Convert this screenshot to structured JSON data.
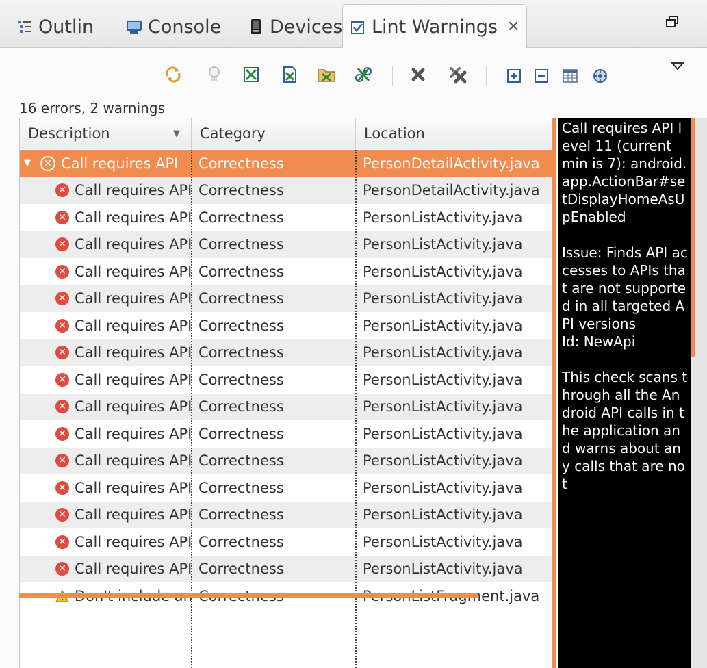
{
  "tabs": [
    {
      "label": "Outlin",
      "icon": "outline-icon",
      "active": false
    },
    {
      "label": "Console",
      "icon": "console-icon",
      "active": false
    },
    {
      "label": "Devices",
      "icon": "devices-icon",
      "active": false
    },
    {
      "label": "Lint Warnings",
      "icon": "lint-icon",
      "active": true
    }
  ],
  "toolbar": {
    "buttons": [
      "refresh-icon",
      "lightbulb-icon",
      "ignore-icon",
      "ignore-file-icon",
      "ignore-project-icon",
      "ignore-all-icon",
      "remove-icon",
      "remove-all-icon",
      "expand-all-icon",
      "collapse-all-icon",
      "columns-icon",
      "options-icon"
    ]
  },
  "summary": "16 errors, 2 warnings",
  "table": {
    "columns": [
      "Description",
      "Category",
      "Location"
    ],
    "rows": [
      {
        "icon": "error",
        "description": "Call requires API",
        "category": "Correctness",
        "location": "PersonDetailActivity.java",
        "selected": true,
        "expander": true
      },
      {
        "icon": "error",
        "description": "Call requires API",
        "category": "Correctness",
        "location": "PersonDetailActivity.java"
      },
      {
        "icon": "error",
        "description": "Call requires API",
        "category": "Correctness",
        "location": "PersonListActivity.java"
      },
      {
        "icon": "error",
        "description": "Call requires API",
        "category": "Correctness",
        "location": "PersonListActivity.java"
      },
      {
        "icon": "error",
        "description": "Call requires API",
        "category": "Correctness",
        "location": "PersonListActivity.java"
      },
      {
        "icon": "error",
        "description": "Call requires API",
        "category": "Correctness",
        "location": "PersonListActivity.java"
      },
      {
        "icon": "error",
        "description": "Call requires API",
        "category": "Correctness",
        "location": "PersonListActivity.java"
      },
      {
        "icon": "error",
        "description": "Call requires API",
        "category": "Correctness",
        "location": "PersonListActivity.java"
      },
      {
        "icon": "error",
        "description": "Call requires API",
        "category": "Correctness",
        "location": "PersonListActivity.java"
      },
      {
        "icon": "error",
        "description": "Call requires API",
        "category": "Correctness",
        "location": "PersonListActivity.java"
      },
      {
        "icon": "error",
        "description": "Call requires API",
        "category": "Correctness",
        "location": "PersonListActivity.java"
      },
      {
        "icon": "error",
        "description": "Call requires API",
        "category": "Correctness",
        "location": "PersonListActivity.java"
      },
      {
        "icon": "error",
        "description": "Call requires API",
        "category": "Correctness",
        "location": "PersonListActivity.java"
      },
      {
        "icon": "error",
        "description": "Call requires API",
        "category": "Correctness",
        "location": "PersonListActivity.java"
      },
      {
        "icon": "error",
        "description": "Call requires API",
        "category": "Correctness",
        "location": "PersonListActivity.java"
      },
      {
        "icon": "error",
        "description": "Call requires API",
        "category": "Correctness",
        "location": "PersonListActivity.java"
      },
      {
        "icon": "warning",
        "description": "Don't include and",
        "category": "Correctness",
        "location": "PersonListFragment.java"
      }
    ]
  },
  "detail": {
    "message": "Call requires API level 11 (current min is 7): android.app.ActionBar#setDisplayHomeAsUpEnabled",
    "issue": "Issue: Finds API accesses to APIs that are not supported in all targeted API versions",
    "id": "Id: NewApi",
    "explanation": "This check scans through all the Android API calls in the application and warns about any calls that are not"
  }
}
